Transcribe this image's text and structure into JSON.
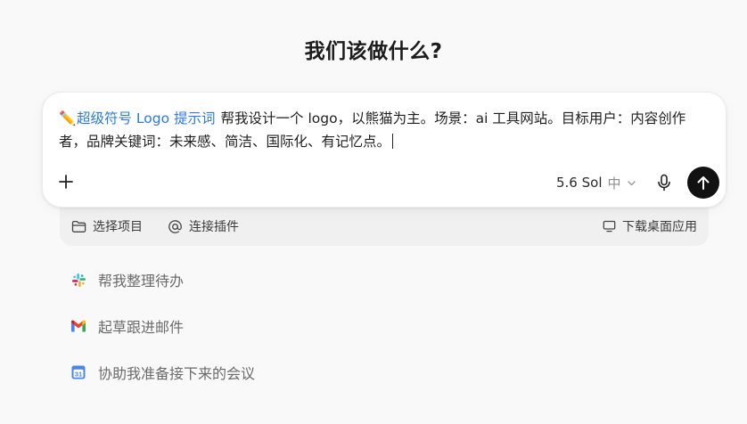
{
  "heading": "我们该做什么?",
  "composer": {
    "chip_label": "超级符号 Logo 提示词",
    "prompt_text": "帮我设计一个 logo，以熊猫为主。场景：ai 工具网站。目标用户：内容创作者，品牌关键词：未来感、简洁、国际化、有记忆点。",
    "model_name": "5.6 Sol",
    "model_level": "中"
  },
  "footer_bar": {
    "select_project": "选择项目",
    "connect_plugin": "连接插件",
    "download_desktop": "下载桌面应用"
  },
  "suggestions": [
    {
      "label": "帮我整理待办",
      "icon": "slack-icon"
    },
    {
      "label": "起草跟进邮件",
      "icon": "gmail-icon"
    },
    {
      "label": "协助我准备接下来的会议",
      "icon": "calendar-icon"
    }
  ],
  "calendar_icon_day": "31",
  "colors": {
    "accent_blue": "#2a7ae2",
    "send_button": "#111111",
    "background": "#f9f9f9"
  }
}
